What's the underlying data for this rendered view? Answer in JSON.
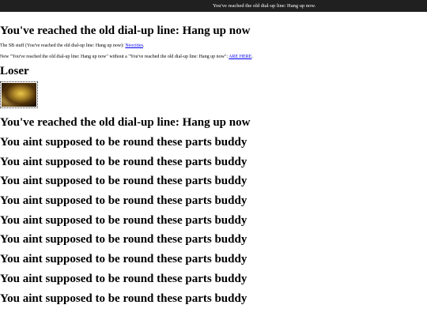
{
  "window": {
    "tab_title": "You've reached the old dial-up line: Hang up now."
  },
  "page": {
    "title": "You've reached the old dial-up line: Hang up now",
    "line1_prefix": "The SB stuff (You've reached the old dial-up line: Hang up now): ",
    "line1_link": "Neocities",
    "line1_suffix": ".",
    "line2_prefix": "New \"You've reached the old dial-up line: Hang up now\" without a \"You've reached the old dial-up line: Hang up now\": ",
    "line2_link": "ARE HERE",
    "line2_suffix": ".",
    "loser_heading": "Loser",
    "repeat_title": "You've reached the old dial-up line: Hang up now",
    "buddy_lines": [
      "You aint supposed to be round these parts buddy",
      "You aint supposed to be round these parts buddy",
      "You aint supposed to be round these parts buddy",
      "You aint supposed to be round these parts buddy",
      "You aint supposed to be round these parts buddy",
      "You aint supposed to be round these parts buddy",
      "You aint supposed to be round these parts buddy",
      "You aint supposed to be round these parts buddy",
      "You aint supposed to be round these parts buddy"
    ]
  },
  "colors": {
    "topbar_bg": "#202020",
    "link": "#0000ee",
    "text": "#000000",
    "background": "#ffffff"
  }
}
